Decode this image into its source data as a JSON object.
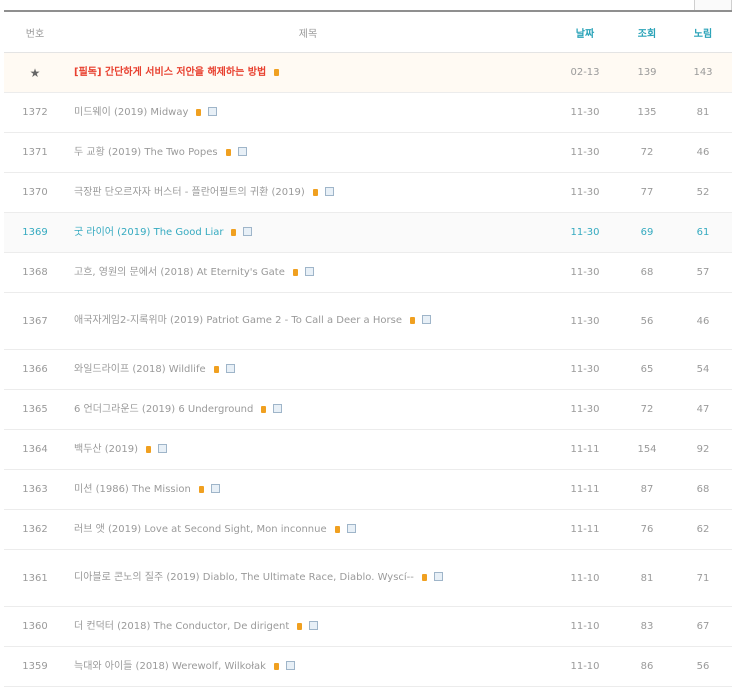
{
  "header": {
    "no": "번호",
    "subject": "제목",
    "date": "날짜",
    "hit": "조회",
    "rec": "노림"
  },
  "colors": {
    "notice": "#e8402f",
    "accent": "#2aa3b8",
    "new_badge": "#f0a020"
  },
  "rows": [
    {
      "no": "★",
      "subject": "[필독] 간단하게 서비스 저안을 해제하는 방법",
      "date": "02-13",
      "hit": "139",
      "rec": "143",
      "notice": true
    },
    {
      "no": "1372",
      "subject": "미드웨이 (2019) Midway",
      "date": "11-30",
      "hit": "135",
      "rec": "81"
    },
    {
      "no": "1371",
      "subject": "두 교황 (2019) The Two Popes",
      "date": "11-30",
      "hit": "72",
      "rec": "46"
    },
    {
      "no": "1370",
      "subject": "극장판 단오르자자 버스터 - 플란어필트의 귀환 (2019)",
      "date": "11-30",
      "hit": "77",
      "rec": "52"
    },
    {
      "no": "1369",
      "subject": "굿 라이어 (2019) The Good Liar",
      "date": "11-30",
      "hit": "69",
      "rec": "61",
      "current": true
    },
    {
      "no": "1368",
      "subject": "고흐, 영원의 문에서 (2018) At Eternity's Gate",
      "date": "11-30",
      "hit": "68",
      "rec": "57"
    },
    {
      "no": "1367",
      "subject": "애국자게임2-지록위마 (2019) Patriot Game 2 - To Call a Deer a Horse",
      "date": "11-30",
      "hit": "56",
      "rec": "46",
      "tall": true
    },
    {
      "no": "1366",
      "subject": "와일드라이프 (2018) Wildlife",
      "date": "11-30",
      "hit": "65",
      "rec": "54"
    },
    {
      "no": "1365",
      "subject": "6 언더그라운드 (2019) 6 Underground",
      "date": "11-30",
      "hit": "72",
      "rec": "47"
    },
    {
      "no": "1364",
      "subject": "백두산 (2019)",
      "date": "11-11",
      "hit": "154",
      "rec": "92"
    },
    {
      "no": "1363",
      "subject": "미션 (1986) The Mission",
      "date": "11-11",
      "hit": "87",
      "rec": "68"
    },
    {
      "no": "1362",
      "subject": "러브 앳 (2019) Love at Second Sight, Mon inconnue",
      "date": "11-11",
      "hit": "76",
      "rec": "62"
    },
    {
      "no": "1361",
      "subject": "디아블로 콘노의 질주 (2019) Diablo, The Ultimate Race, Diablo. Wyscí--",
      "date": "11-10",
      "hit": "81",
      "rec": "71",
      "tall": true
    },
    {
      "no": "1360",
      "subject": "더 컨덕터 (2018) The Conductor, De dirigent",
      "date": "11-10",
      "hit": "83",
      "rec": "67"
    },
    {
      "no": "1359",
      "subject": "늑대와 아이들 (2018) Werewolf, Wilkołak",
      "date": "11-10",
      "hit": "86",
      "rec": "56"
    }
  ]
}
